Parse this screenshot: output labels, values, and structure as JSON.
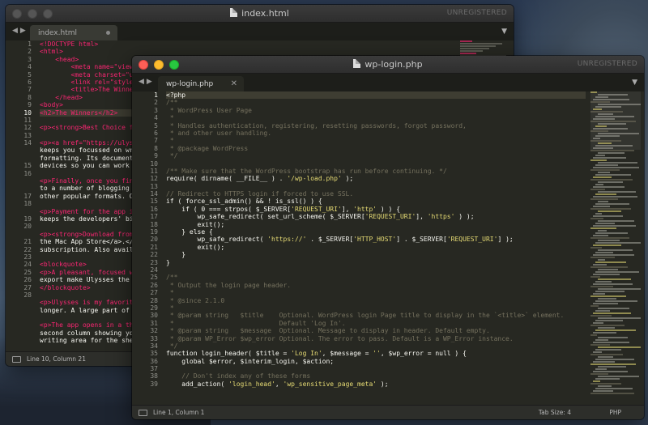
{
  "background_window": {
    "title": "index.html",
    "unregistered_label": "UNREGISTERED",
    "tab": {
      "label": "index.html"
    },
    "status": {
      "position": "Line 10, Column 21"
    },
    "line_numbers": [
      "1",
      "2",
      "3",
      "4",
      "5",
      "6",
      "7",
      "8",
      "9",
      "10",
      "11",
      "12",
      "13",
      "14",
      "",
      "",
      "15",
      "16",
      "",
      "",
      "17",
      "18",
      "",
      "19",
      "20",
      "",
      "21",
      "22",
      "23",
      "24",
      "25",
      "26",
      "27",
      "28",
      "",
      ""
    ],
    "code_lines": [
      "<!DOCTYPE html>",
      "<html>",
      "    <head>",
      "        <meta name=\"viewp",
      "        <meta charset=\"ut",
      "        <link rel=\"styles",
      "        <title>The Winner",
      "    </head>",
      "<body>",
      "<h2>The Winners</h2>",
      "",
      "<p><strong>Best Choice fo",
      "",
      "<p><a href=\"https://ulyss",
      "keeps you focussed on wri",
      "formatting. Its document",
      "devices so you can work a",
      "",
      "<p>Finally, once you fini",
      "to a number of blogging f",
      "other popular formats. Or",
      "",
      "<p>Payment for the app is",
      "keeps the developers' bil",
      "",
      "<p><strong>Download from",
      "the Mac App Store</a>.</",
      "subscription. Also availa",
      "",
      "<blockquote>",
      "<p>A pleasant, focused wr",
      "export make Ulysses the f",
      "</blockquote>",
      "",
      "<p>Ulysses is my favorite",
      "longer. A large part of t",
      "",
      "<p>The app opens in a thr",
      "second column showing you",
      "writing area for the shee"
    ]
  },
  "foreground_window": {
    "title": "wp-login.php",
    "unregistered_label": "UNREGISTERED",
    "tab": {
      "label": "wp-login.php"
    },
    "status": {
      "position": "Line 1, Column 1",
      "tab_size": "Tab Size: 4",
      "syntax": "PHP"
    },
    "code_lines": [
      "<?php",
      "/**",
      " * WordPress User Page",
      " *",
      " * Handles authentication, registering, resetting passwords, forgot password,",
      " * and other user handling.",
      " *",
      " * @package WordPress",
      " */",
      "",
      "/** Make sure that the WordPress bootstrap has run before continuing. */",
      "require( dirname( __FILE__ ) . '/wp-load.php' );",
      "",
      "// Redirect to HTTPS login if forced to use SSL.",
      "if ( force_ssl_admin() && ! is_ssl() ) {",
      "    if ( 0 === strpos( $_SERVER['REQUEST_URI'], 'http' ) ) {",
      "        wp_safe_redirect( set_url_scheme( $_SERVER['REQUEST_URI'], 'https' ) );",
      "        exit();",
      "    } else {",
      "        wp_safe_redirect( 'https://' . $_SERVER['HTTP_HOST'] . $_SERVER['REQUEST_URI'] );",
      "        exit();",
      "    }",
      "}",
      "",
      "/**",
      " * Output the login page header.",
      " *",
      " * @since 2.1.0",
      " *",
      " * @param string   $title    Optional. WordPress login Page title to display in the `<title>` element.",
      " *                           Default 'Log In'.",
      " * @param string   $message  Optional. Message to display in header. Default empty.",
      " * @param WP_Error $wp_error Optional. The error to pass. Default is a WP_Error instance.",
      " */",
      "function login_header( $title = 'Log In', $message = '', $wp_error = null ) {",
      "    global $error, $interim_login, $action;",
      "",
      "    // Don't index any of these forms",
      "    add_action( 'login_head', 'wp_sensitive_page_meta' );"
    ]
  }
}
